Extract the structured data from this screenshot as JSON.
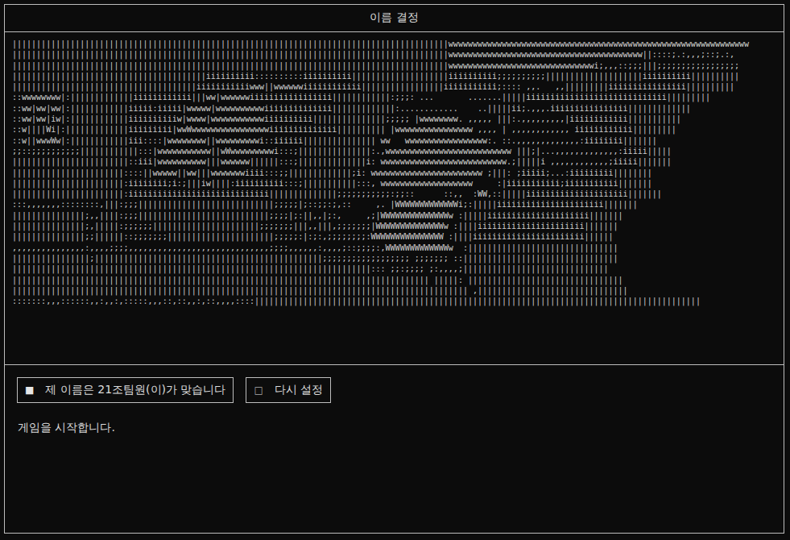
{
  "window": {
    "title": "이름 결정"
  },
  "art": {
    "lines": [
      "||||||||||||||||||||||||||||||||||||||||||||||||||||||||||||||||||||||||||||||||||||||||||wwwwwwwwwwwwwwwwwwwwwwwwwwwwwwwwwwwwwwwwwwwwwwwwwwwwwwwwwwwwww",
      "||||||||||||||||||||||||||||||||||||||||||||||||||||||||||||||||||||||||||||||||||||||||||wwwwwwwwwwwwwwwwwwwwwwwwwwwwwwwwwwwwwwww||::::;.:,,,;::;.:,",
      "||||||||||||||||||||||||||||||||||||||||||||||||||||||||||||||||||||||||||||||||||||||||||wwwwwwwwwwwwwwwwwwwwwwwwwwwwwwi;,,,::;;;|||;;;;;;;;;;;;;;;;;",
      "||||||||||||||||||||||||||||||||||||||||iiiiiiiiii::::::::::iiiiiiiiii||||||||||||||||||||iiiiiiiiii;;;;;;;;;;||||||||||||||||||||iiiiiiiiii||||||||||",
      "||||||||||||||||||||||||||||||||||||||iiiiiiiiiiiwww||wwwwwwiiiiiiiiiiii|||||||||||||||||iiiiiiiiiii;:::: ,,.   ,,|||||||||iiiiiiiiiiiiiiii||||||||||",
      "::wwwwwwww|:|||||||||||||iiiiiiiiiiii|||ww|wwwwwwiiiiiiiiiiiiiiiii||||||||||||:;;;: ...       .......|||||iiiiiiiiiiiiiiiiiiiiiiiiiiiii|||||||||",
      "::ww|ww|ww|:||||||||||||iiiii:iiiii|wwwww|wwwwwwwwwwiiiiiiiiiiiiii|||||||||||||:............    ..|||||ii;.,,,.iiiiiiiiiiiiiiii|||||||||||||",
      "::ww|ww|iw|:||||||||||||iiiiiiiiiiw|wwww|wwwwwwwwwwwiiiiiiiiii|||||||||||||||;;;;; |wwwwwwww. ,,,,, |||:.,,,,,,,,,|iiiiiiiiiiii|||||||||||",
      "::w||||Wi|:|||||||||||||iiiiiiiii|wwWwwwwwwwwwwwwwwwwiiiiiiiiiiiiii|||||||||| |wwwwwwwwwwwwwwww ,,,, | ,,,,,,,,,,,, iiiiiiiiiiii|||||||||",
      "::w||wwwWw|:||||||||||||iii::::|wwwwwwww||wwwwwwwwwi::iiiiii||||||||||||||| ww   wwwwwwwwwwwwwwwww:. ::.,,,,,,,,,,,,,:iiiiiiii|||||||",
      ";;::;;;;;;;;;;||||||||||||:::|wwwwwwwwwww||wWwwwwwwwwwi:::;|||||||||||||||:.,wwwwwwwwwwwwwwwwwwwwwwwwww |||;|...,,,,,,,,,,,,,:iiiii|||||",
      "||||||||||||||||||||||||::iii|wwwwwwwwww|||wwwwww||||||:::;||||||||||||||i: wwwwwwwwwwwwwwwwwwwwwwwwww.;|||||i ,,,,,,,,,,,,;iiiii|||||||",
      "|||||||||||||||||||||||::::||wwwww||ww|||wwwwwwwiiii:::;;|||||||||||||;i: wwwwwwwwwwwwwwwwwwwwwww ;|||: ;iiiii;...:iiiiiiiii||||||||",
      "|||||||||||||||||||||||:iiiiiiii;i:;|||iw||||:iiiiiiiiii:::;|||||||||||:::, wwwwwwwwwwwwwwwwwww     :|iiiiiiiiiii;iiiiiiiiiii|||||||",
      "|||||||||||||||||||||||:iiiiiiiiiiiiiiiiiiiiiiiiiiiii||||||||||||||;;;;;;;;;;;:;;::      ::,,  :WW,::|||||iiiiiiiiiiiiiiiiiiiii|||||||",
      ":::,,,,,,,::::::::,|||:;;;||||||||||||||||||||||||||||;;;;;|;::;;:;,::     ,. |WWWWWWWWWWWWWi;:|||||iiiiiiiiiiiiiiiiiiiiii|||||||",
      "|||||||||||||||;,,||||:;;;|||||||||||||||||||||||||||;;;;|;:||,,|;:,     ,;|WWWWWWWWWWWWWWw :|||||iiiiiiiiiiiiiiiiiiiii|||||||",
      "|||||||||||||||;,|||||:;;;;;;||||||||||||||||||||||;;;;;;;|||,,|||,;;;;;;;|WWWWWWWWWWWWWWw :||||iiiiiiiiiiiiiiiiiiiiii|||||||",
      "|||||||||||||||;;||||||::;;;;;;;||||||||||||||||||||||;;;;;:|:;:,;;;;;;;;:WWWWWWWWWWWWWWW :||||iiiiiiiiiiiiiiiiiiiiiii||||||",
      ",,,,,,,,,,,,,,,:,,,,;;;;,,,,,,,,,,,,,,,,,,,,,,,,,,,,,;;;;,,,,,,:,,,,;::;;;;:,WWWWWWWWWWWWWw  :|||||||||||||||||||||||||||||||",
      "||||||||||||||||;|||||||||||||||||||||||||||||||||||||||||||||||;;;;;;;;;;;;;;;;;; ;;;;;;; ::||||||||||||||||||||||||||||||||",
      "||||||||||||||||||||||||||||||||||||||||||||||||||||||||||||||||||||||||||::: ;;:;;;; ;:,,,,;||||||||||||||||||||||||||||||",
      "|||||||||||||||||||||||||||||||||||||||||||||||||||||||||||||||||||||||||||||||||||||| |||||: ||||||||||||||||||||||||||||||||",
      "|||||||||||||||||||||||||||||||||||||||||||||||||||||||||||||||||||||||||||||||||||||||||||||| ,|||||||||||||||||||||||||||||||",
      ":::::::,,,::::::,,:,,:,:::::,,,::,::,,:,::,,,,::::||||||||||||||||||||||||||||||||||||||||||||||||||||||||||||||||||||||||||||||||||||||||||||"
    ]
  },
  "options": [
    {
      "icon": "■",
      "label": "제 이름은 21조팀원(이)가 맞습니다",
      "selected": true
    },
    {
      "icon": "□",
      "label": "다시 설정",
      "selected": false
    }
  ],
  "message": "게임을 시작합니다."
}
